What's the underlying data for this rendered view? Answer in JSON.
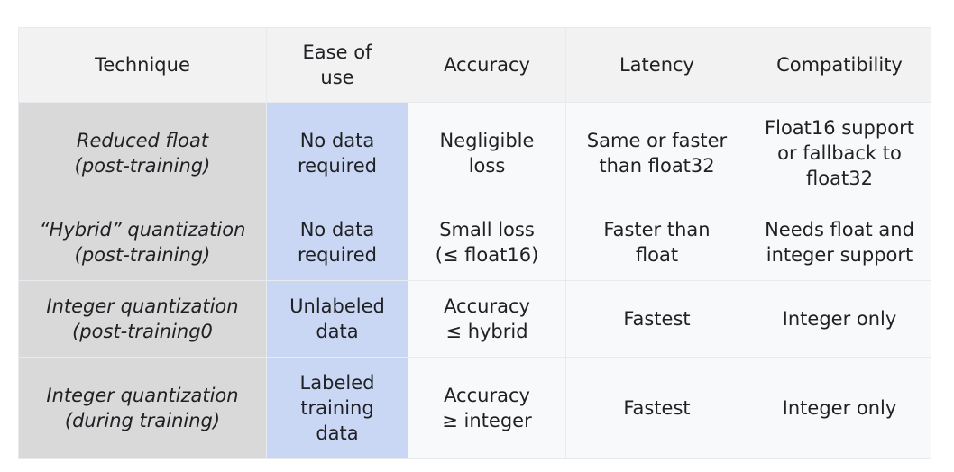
{
  "table": {
    "headers": [
      "Technique",
      "Ease of use",
      "Accuracy",
      "Latency",
      "Compatibility"
    ],
    "header_lines": [
      [
        "Technique"
      ],
      [
        "Ease of",
        "use"
      ],
      [
        "Accuracy"
      ],
      [
        "Latency"
      ],
      [
        "Compatibility"
      ]
    ],
    "rows": [
      {
        "technique": [
          "Reduced float",
          "(post-training)"
        ],
        "ease_of_use": [
          "No data",
          "required"
        ],
        "accuracy": [
          "Negligible",
          "loss"
        ],
        "latency": [
          "Same or faster",
          "than float32"
        ],
        "compatibility": [
          "Float16 support",
          "or fallback to",
          "float32"
        ]
      },
      {
        "technique": [
          "“Hybrid” quantization",
          "(post-training)"
        ],
        "ease_of_use": [
          "No data",
          "required"
        ],
        "accuracy": [
          "Small loss",
          "(≤ float16)"
        ],
        "latency": [
          "Faster than",
          "float"
        ],
        "compatibility": [
          "Needs float and",
          "integer support"
        ]
      },
      {
        "technique": [
          "Integer quantization",
          "(post-training0"
        ],
        "ease_of_use": [
          "Unlabeled",
          "data"
        ],
        "accuracy": [
          "Accuracy",
          "≤ hybrid"
        ],
        "latency": [
          "Fastest"
        ],
        "compatibility": [
          "Integer only"
        ]
      },
      {
        "technique": [
          "Integer quantization",
          "(during training)"
        ],
        "ease_of_use": [
          "Labeled",
          "training",
          "data"
        ],
        "accuracy": [
          "Accuracy",
          "≥ integer"
        ],
        "latency": [
          "Fastest"
        ],
        "compatibility": [
          "Integer only"
        ]
      }
    ],
    "colors": {
      "header_bg": "#f2f2f2",
      "technique_bg": "#d9d9d9",
      "ease_bg": "#c9d7f4",
      "cell_bg": "#f8f9fb",
      "text": "#202124"
    }
  }
}
